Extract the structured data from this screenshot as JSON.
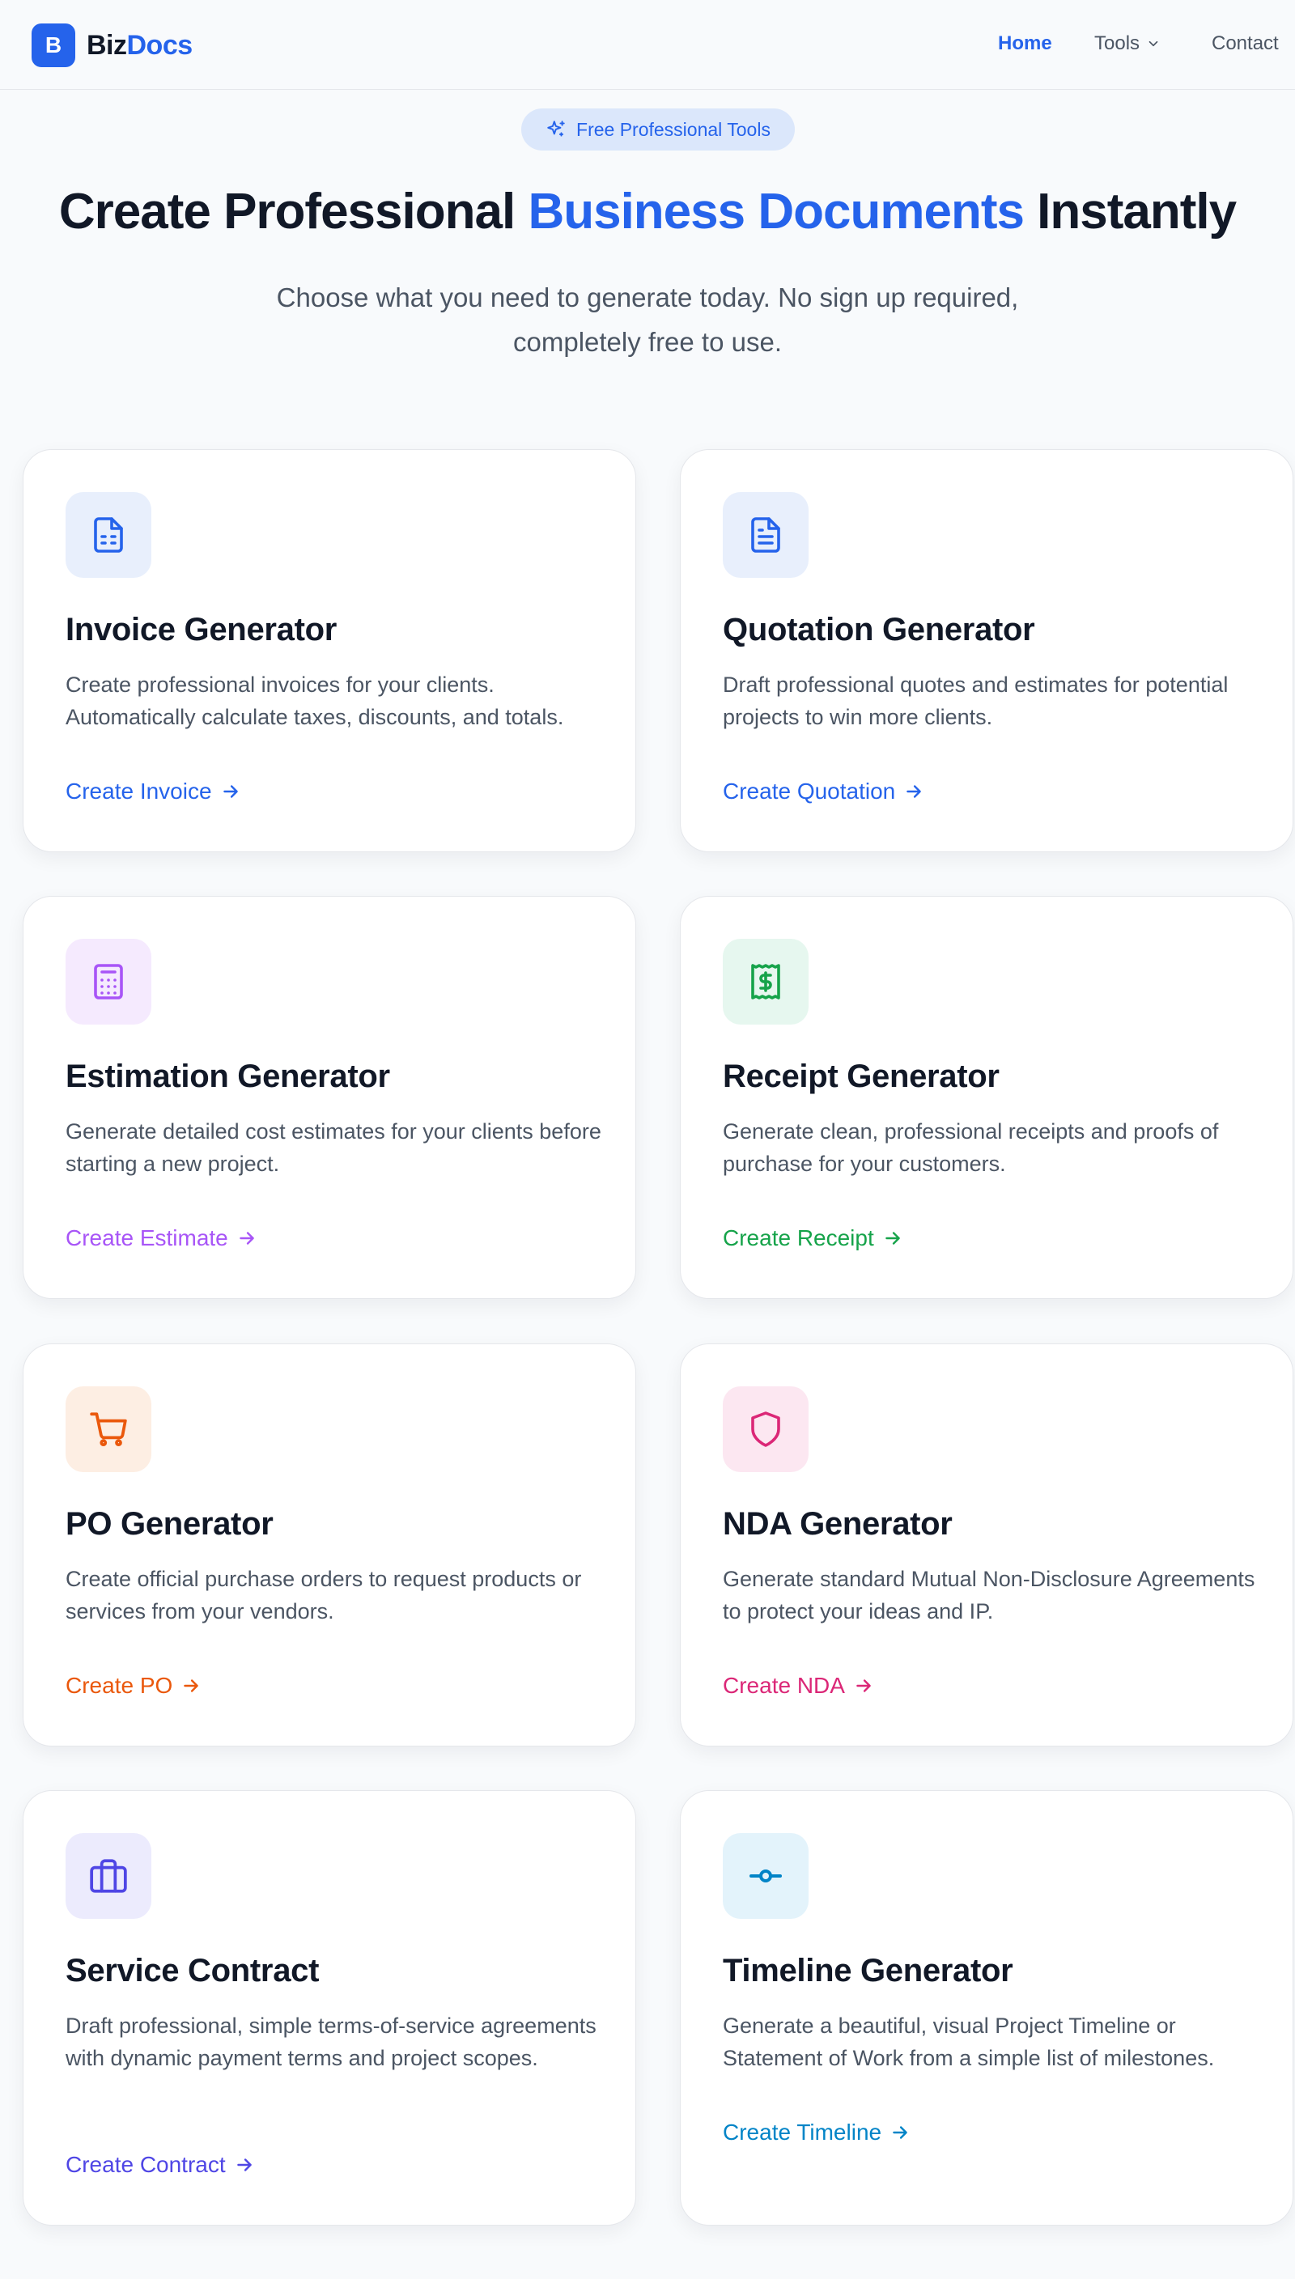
{
  "header": {
    "logo_letter": "B",
    "logo_text_1": "Biz",
    "logo_text_2": "Docs",
    "nav": {
      "home": "Home",
      "tools": "Tools",
      "contact": "Contact"
    }
  },
  "hero": {
    "badge": "Free Professional Tools",
    "title_1": "Create Professional ",
    "title_accent": "Business Documents",
    "title_2": " Instantly",
    "subtitle": "Choose what you need to generate today. No sign up required, completely free to use."
  },
  "cards": [
    {
      "title": "Invoice Generator",
      "desc": "Create professional invoices for your clients. Automatically calculate taxes, discounts, and totals.",
      "link": "Create Invoice",
      "icon": "invoice-icon",
      "color": "#2563eb"
    },
    {
      "title": "Quotation Generator",
      "desc": "Draft professional quotes and estimates for potential projects to win more clients.",
      "link": "Create Quotation",
      "icon": "document-icon",
      "color": "#2563eb"
    },
    {
      "title": "Estimation Generator",
      "desc": "Generate detailed cost estimates for your clients before starting a new project.",
      "link": "Create Estimate",
      "icon": "calculator-icon",
      "color": "#a855f7"
    },
    {
      "title": "Receipt Generator",
      "desc": "Generate clean, professional receipts and proofs of purchase for your customers.",
      "link": "Create Receipt",
      "icon": "receipt-icon",
      "color": "#16a34a"
    },
    {
      "title": "PO Generator",
      "desc": "Create official purchase orders to request products or services from your vendors.",
      "link": "Create PO",
      "icon": "cart-icon",
      "color": "#ea580c"
    },
    {
      "title": "NDA Generator",
      "desc": "Generate standard Mutual Non-Disclosure Agreements to protect your ideas and IP.",
      "link": "Create NDA",
      "icon": "shield-icon",
      "color": "#db2777"
    },
    {
      "title": "Service Contract",
      "desc": "Draft professional, simple terms-of-service agreements with dynamic payment terms and project scopes.",
      "link": "Create Contract",
      "icon": "briefcase-icon",
      "color": "#4f46e5"
    },
    {
      "title": "Timeline Generator",
      "desc": "Generate a beautiful, visual Project Timeline or Statement of Work from a simple list of milestones.",
      "link": "Create Timeline",
      "icon": "timeline-icon",
      "color": "#0284c7"
    }
  ]
}
